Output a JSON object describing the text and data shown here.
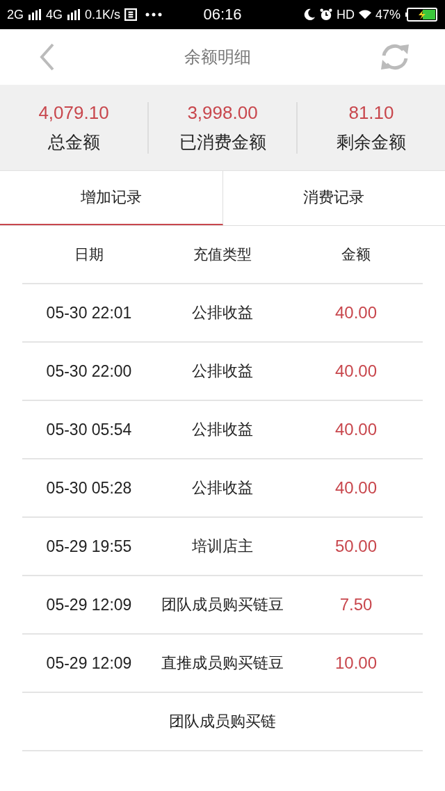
{
  "status_bar": {
    "network_1": "2G",
    "network_2": "4G",
    "speed": "0.1K/s",
    "time": "06:16",
    "hd": "HD",
    "battery": "47%"
  },
  "header": {
    "title": "余额明细"
  },
  "summary": [
    {
      "value": "4,079.10",
      "label": "总金额"
    },
    {
      "value": "3,998.00",
      "label": "已消费金额"
    },
    {
      "value": "81.10",
      "label": "剩余金额"
    }
  ],
  "tabs": [
    {
      "label": "增加记录",
      "selected": true
    },
    {
      "label": "消费记录",
      "selected": false
    }
  ],
  "table": {
    "columns": [
      "日期",
      "充值类型",
      "金额"
    ],
    "rows": [
      {
        "date": "05-30 22:01",
        "type": "公排收益",
        "amount": "40.00"
      },
      {
        "date": "05-30 22:00",
        "type": "公排收益",
        "amount": "40.00"
      },
      {
        "date": "05-30 05:54",
        "type": "公排收益",
        "amount": "40.00"
      },
      {
        "date": "05-30 05:28",
        "type": "公排收益",
        "amount": "40.00"
      },
      {
        "date": "05-29 19:55",
        "type": "培训店主",
        "amount": "50.00"
      },
      {
        "date": "05-29 12:09",
        "type": "团队成员购买链豆",
        "amount": "7.50"
      },
      {
        "date": "05-29 12:09",
        "type": "直推成员购买链豆",
        "amount": "10.00"
      },
      {
        "type": "团队成员购买链"
      }
    ]
  }
}
